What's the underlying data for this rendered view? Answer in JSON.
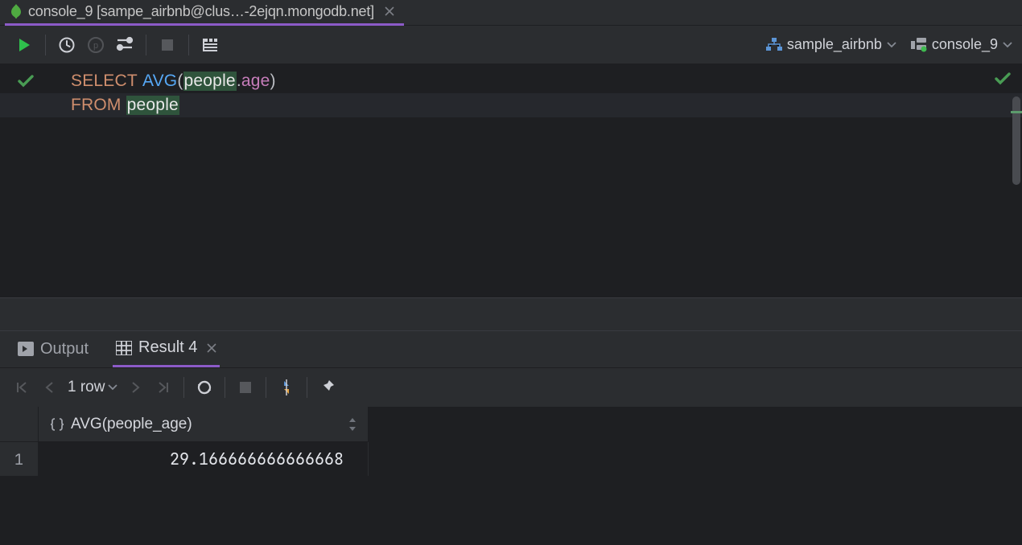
{
  "tab": {
    "title": "console_9 [sampe_airbnb@clus…-2ejqn.mongodb.net]",
    "icon": "mongodb-leaf"
  },
  "context": {
    "database_label": "sample_airbnb",
    "console_label": "console_9"
  },
  "editor": {
    "lines": [
      {
        "select": "SELECT",
        "func": "AVG",
        "lp": "(",
        "tbl": "people",
        "dot": ".",
        "col": "age",
        "rp": ")"
      },
      {
        "from": "FROM",
        "tbl": "people"
      }
    ]
  },
  "results": {
    "output_tab": "Output",
    "result_tab": "Result 4",
    "row_count_label": "1 row",
    "column_header": "AVG(people_age)",
    "rows": [
      {
        "n": "1",
        "value": "29.166666666666668"
      }
    ]
  }
}
